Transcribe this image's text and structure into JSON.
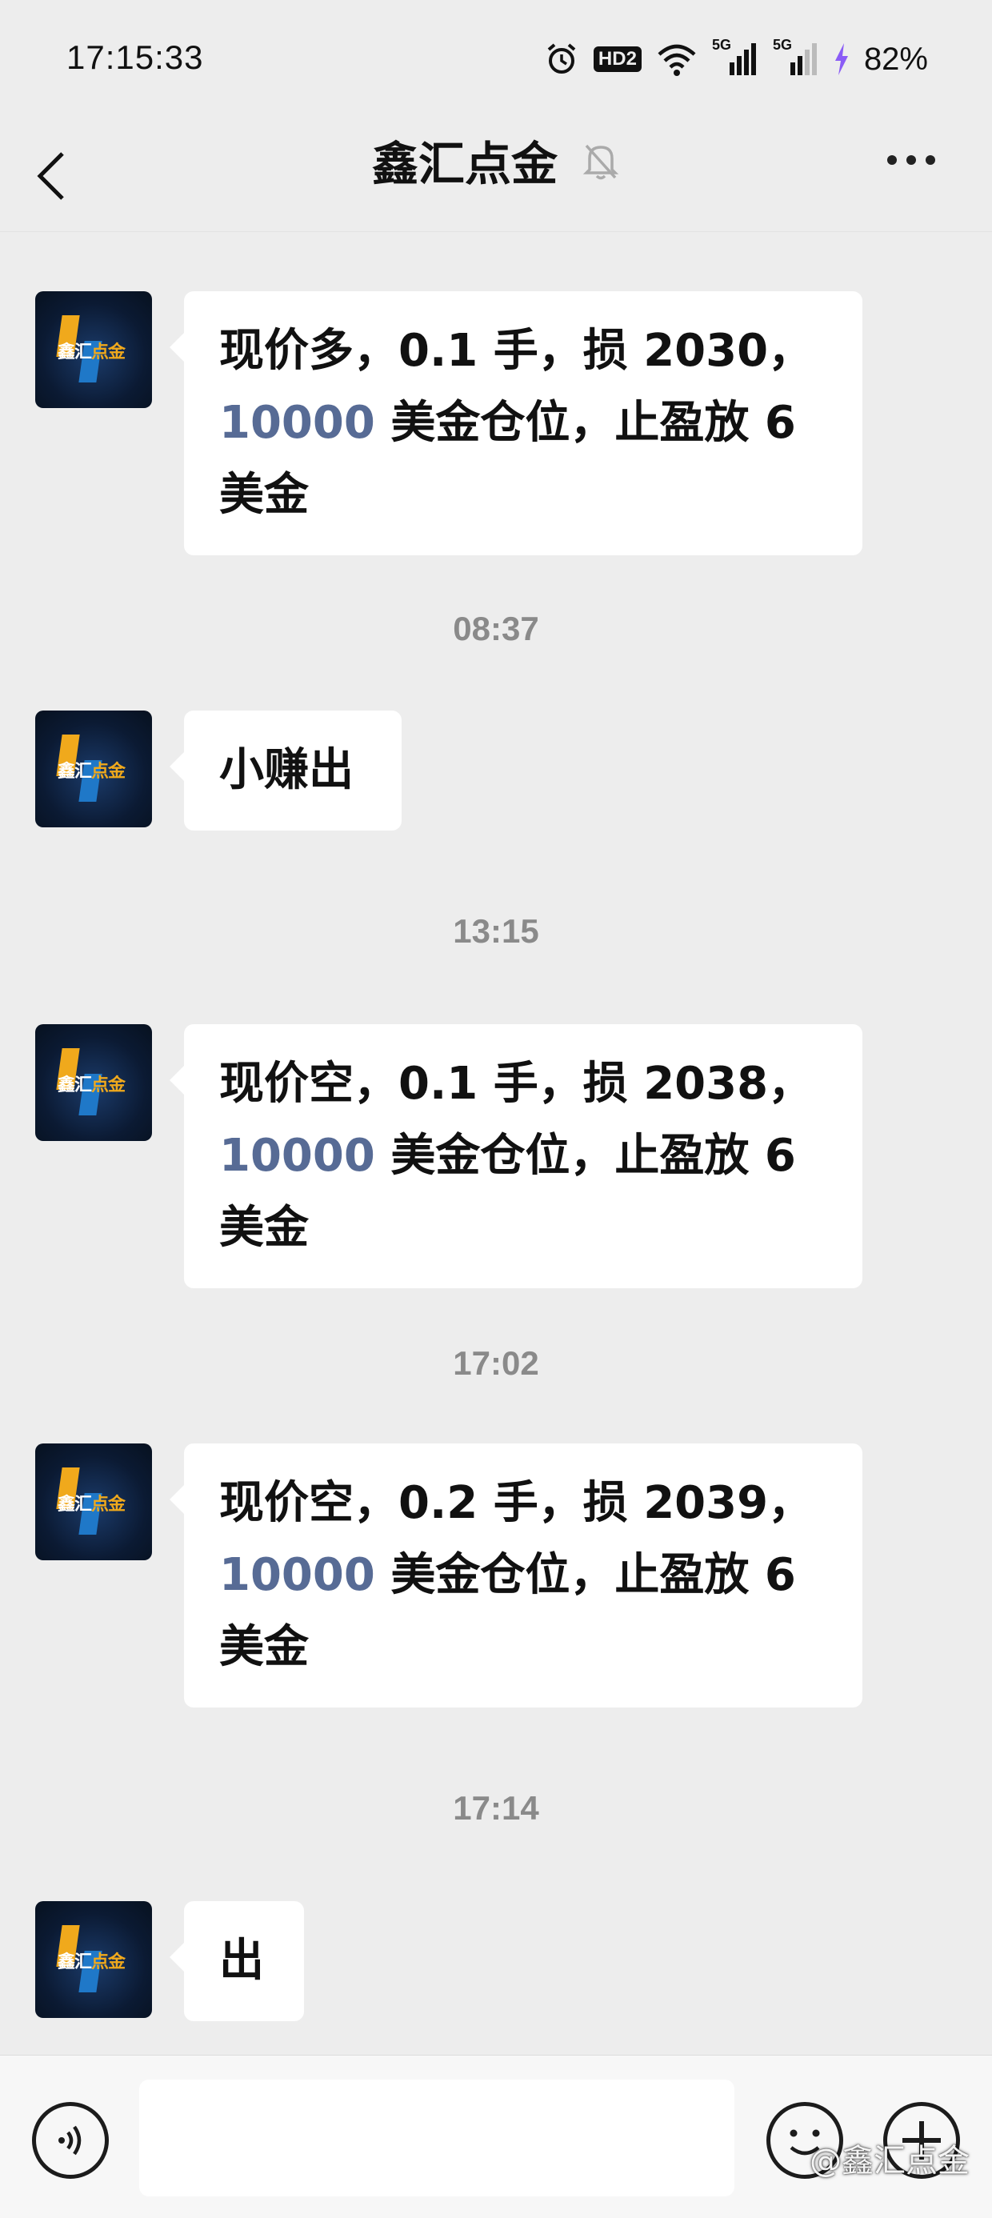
{
  "status_bar": {
    "time": "17:15:33",
    "hd_label": "HD2",
    "network_1": "5G",
    "network_2": "5G",
    "battery": "82%"
  },
  "header": {
    "title": "鑫汇点金"
  },
  "avatar": {
    "logo_text_1": "鑫汇",
    "logo_text_2": "点金"
  },
  "messages": [
    {
      "type": "text",
      "line1": "现价多，0.1 手，损 2030，",
      "highlight": "10000",
      "rest": " 美金仓位，止盈放 6",
      "line3": "美金"
    },
    {
      "type": "time",
      "text": "08:37"
    },
    {
      "type": "text",
      "text": "小赚出"
    },
    {
      "type": "time",
      "text": "13:15"
    },
    {
      "type": "text",
      "line1": "现价空，0.1 手，损 2038，",
      "highlight": "10000",
      "rest": " 美金仓位，止盈放 6",
      "line3": "美金"
    },
    {
      "type": "time",
      "text": "17:02"
    },
    {
      "type": "text",
      "line1": "现价空，0.2 手，损 2039，",
      "highlight": "10000",
      "rest": " 美金仓位，止盈放 6",
      "line3": "美金"
    },
    {
      "type": "time",
      "text": "17:14"
    },
    {
      "type": "text",
      "text": "出"
    }
  ],
  "input_bar": {
    "placeholder": "",
    "watermark": "@鑫汇点金"
  },
  "colors": {
    "background": "#ededed",
    "bubble": "#ffffff",
    "accent_link": "#576b95",
    "time_text": "#8a8a8a"
  },
  "icons": [
    "back-arrow-icon",
    "muted-bell-icon",
    "more-icon",
    "alarm-icon",
    "wifi-icon",
    "signal-icon",
    "charging-icon",
    "voice-icon",
    "emoji-icon",
    "plus-icon"
  ]
}
